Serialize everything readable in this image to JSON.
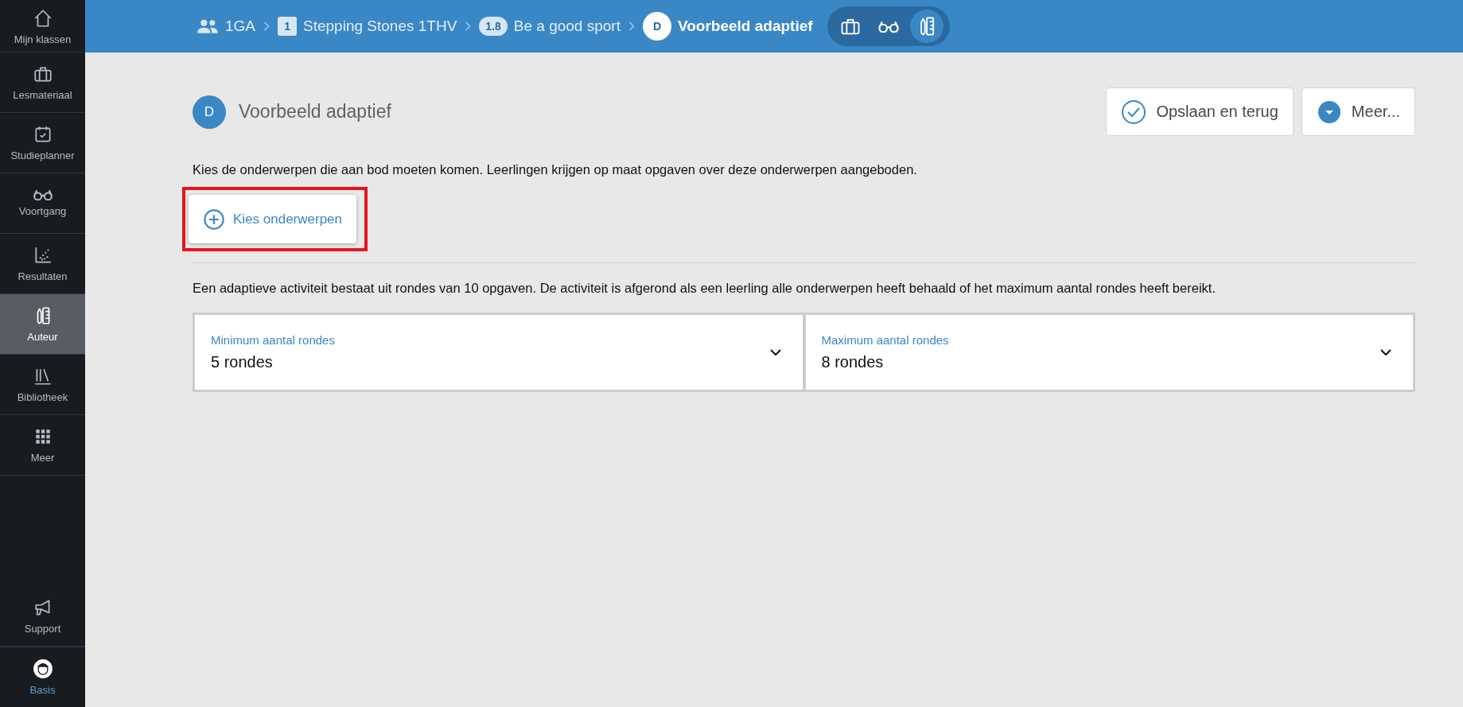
{
  "sidebar": {
    "items": [
      {
        "label": "Mijn klassen",
        "selected": false
      },
      {
        "label": "Lesmateriaal",
        "selected": false
      },
      {
        "label": "Studieplanner",
        "selected": false
      },
      {
        "label": "Voortgang",
        "selected": false
      },
      {
        "label": "Resultaten",
        "selected": false
      },
      {
        "label": "Auteur",
        "selected": true
      },
      {
        "label": "Bibliotheek",
        "selected": false
      },
      {
        "label": "Meer",
        "selected": false
      }
    ],
    "bottom_items": [
      {
        "label": "Support"
      },
      {
        "label": "Basis"
      }
    ]
  },
  "breadcrumb": [
    {
      "kind": "group",
      "label": "1GA"
    },
    {
      "kind": "badge",
      "badge": "1",
      "label": "Stepping Stones 1THV"
    },
    {
      "kind": "pill",
      "badge": "1.8",
      "label": "Be a good sport"
    },
    {
      "kind": "circle",
      "badge": "D",
      "label": "Voorbeeld adaptief"
    }
  ],
  "view_switcher": [
    {
      "selected": false
    },
    {
      "selected": false
    },
    {
      "selected": true
    }
  ],
  "header": {
    "badge": "D",
    "title": "Voorbeeld adaptief",
    "buttons": [
      {
        "kind": "save",
        "label": "Opslaan en terug"
      },
      {
        "kind": "more",
        "label": "Meer..."
      }
    ]
  },
  "topics": {
    "description": "Kies de onderwerpen die aan bod moeten komen. Leerlingen krijgen op maat opgaven over deze onderwerpen aangeboden.",
    "button": "Kies onderwerpen",
    "highlighted": true
  },
  "rounds": {
    "description": "Een adaptieve activiteit bestaat uit rondes van 10 opgaven. De activiteit is afgerond als een leerling alle onderwerpen heeft behaald of het maximum aantal rondes heeft bereikt.",
    "selects": [
      {
        "label": "Minimum aantal rondes",
        "value": "5 rondes"
      },
      {
        "label": "Maximum aantal rondes",
        "value": "8 rondes"
      }
    ]
  }
}
